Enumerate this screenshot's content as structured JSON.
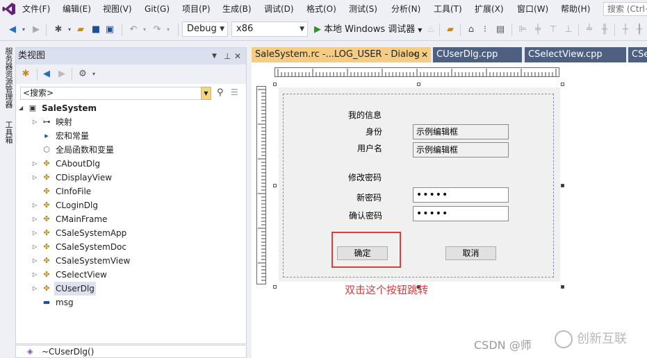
{
  "menubar": {
    "items": [
      "文件(F)",
      "编辑(E)",
      "视图(V)",
      "Git(G)",
      "项目(P)",
      "生成(B)",
      "调试(D)",
      "格式(O)",
      "测试(S)",
      "分析(N)",
      "工具(T)",
      "扩展(X)",
      "窗口(W)",
      "帮助(H)"
    ],
    "search_placeholder": "搜索 (Ctrl+"
  },
  "toolbar": {
    "config": "Debug",
    "platform": "x86",
    "run_label": "本地 Windows 调试器"
  },
  "side_strip": {
    "tabs": [
      "服务器资源管理器",
      "工具箱"
    ]
  },
  "class_view": {
    "title": "类视图",
    "search_placeholder": "<搜索>",
    "tree": [
      {
        "label": "SaleSystem",
        "icon": "project-icon",
        "expanded": true,
        "bold": true,
        "indent": 0
      },
      {
        "label": "映射",
        "icon": "key-icon",
        "expander": true
      },
      {
        "label": "宏和常量",
        "icon": "macro-icon",
        "expander": false
      },
      {
        "label": "全局函数和变量",
        "icon": "global-cube-icon",
        "expander": false
      },
      {
        "label": "CAboutDlg",
        "icon": "class-icon",
        "expander": true
      },
      {
        "label": "CDisplayView",
        "icon": "class-icon",
        "expander": true
      },
      {
        "label": "CInfoFile",
        "icon": "class-icon",
        "expander": false
      },
      {
        "label": "CLoginDlg",
        "icon": "class-icon",
        "expander": true
      },
      {
        "label": "CMainFrame",
        "icon": "class-icon",
        "expander": true
      },
      {
        "label": "CSaleSystemApp",
        "icon": "class-icon",
        "expander": true
      },
      {
        "label": "CSaleSystemDoc",
        "icon": "class-icon",
        "expander": true
      },
      {
        "label": "CSaleSystemView",
        "icon": "class-icon",
        "expander": true
      },
      {
        "label": "CSelectView",
        "icon": "class-icon",
        "expander": true
      },
      {
        "label": "CUserDlg",
        "icon": "class-icon",
        "expander": true,
        "selected": true
      },
      {
        "label": "msg",
        "icon": "struct-icon",
        "expander": false
      }
    ],
    "bottom_item": "~CUserDlg()"
  },
  "tabs": [
    {
      "label": "SaleSystem.rc -...LOG_USER - Dialog",
      "active": true
    },
    {
      "label": "CUserDlg.cpp",
      "active": false
    },
    {
      "label": "CSelectView.cpp",
      "active": false
    },
    {
      "label": "CSe",
      "active": false
    }
  ],
  "dialog": {
    "group1": "我的信息",
    "identity_label": "身份",
    "identity_value": "示例编辑框",
    "username_label": "用户名",
    "username_value": "示例编辑框",
    "group2": "修改密码",
    "newpwd_label": "新密码",
    "newpwd_value": "•••••",
    "confirm_label": "确认密码",
    "confirm_value": "•••••",
    "ok_button": "确定",
    "cancel_button": "取消"
  },
  "annotation": "双击这个按钮跳转",
  "watermark": "CSDN @师",
  "brand_watermark": "创新互联",
  "colors": {
    "highlight": "#e03a3a",
    "active_tab": "#f5cc84",
    "inactive_tab": "#4d6082",
    "vs_purple": "#68217a"
  }
}
